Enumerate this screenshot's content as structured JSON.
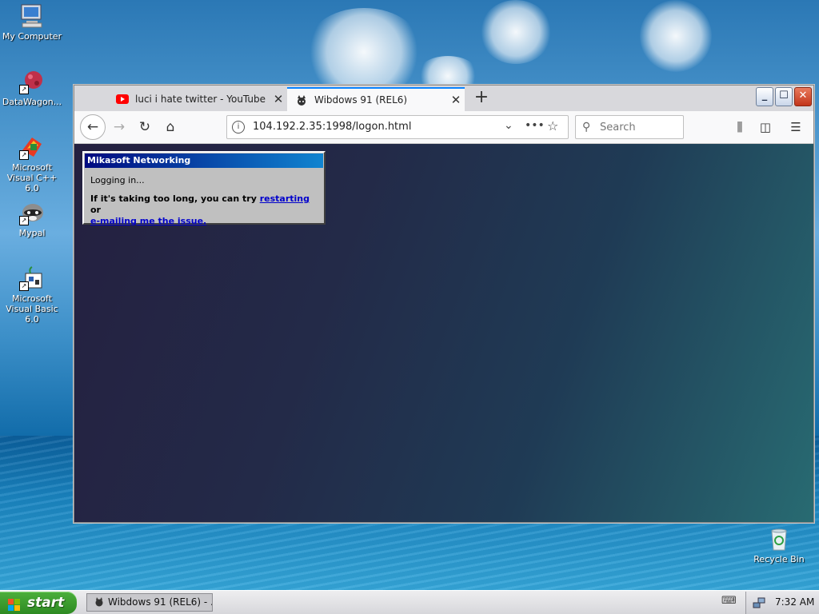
{
  "desktop": {
    "icons": [
      {
        "label": "My Computer"
      },
      {
        "label": "DataWagon..."
      },
      {
        "label": "Microsoft Visual C++ 6.0"
      },
      {
        "label": "Mypal"
      },
      {
        "label": "Microsoft Visual Basic 6.0"
      },
      {
        "label": "Recycle Bin"
      }
    ]
  },
  "browser": {
    "tabs": [
      {
        "title": "luci i hate twitter - YouTube",
        "favicon": "youtube-icon",
        "active": false
      },
      {
        "title": "Wibdows 91 (REL6)",
        "favicon": "cat-icon",
        "active": true
      }
    ],
    "new_tab": "+",
    "url": "104.192.2.35:1998/logon.html",
    "search_placeholder": "Search",
    "accent": "#0a84ff"
  },
  "dialog": {
    "title": "Mikasoft Networking",
    "status": "Logging in...",
    "message_prefix": "If it's taking too long, you can try ",
    "restart_link": "restarting",
    "message_mid": " or",
    "email_link": "e-mailing me the issue."
  },
  "taskbar": {
    "start_label": "start",
    "task_item": "Wibdows 91 (REL6) - ...",
    "clock": "7:32 AM"
  }
}
